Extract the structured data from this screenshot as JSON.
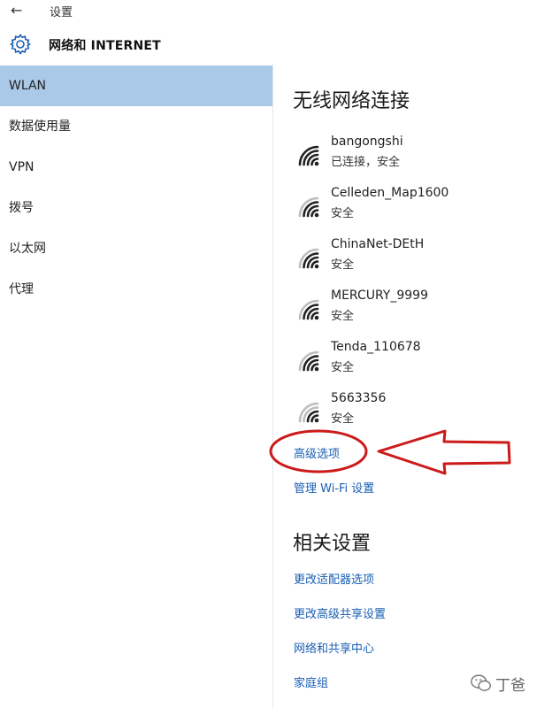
{
  "titlebar": {
    "back_glyph": "←",
    "app_title": "设置"
  },
  "header": {
    "title": "网络和 INTERNET"
  },
  "sidebar": {
    "items": [
      {
        "label": "WLAN"
      },
      {
        "label": "数据使用量"
      },
      {
        "label": "VPN"
      },
      {
        "label": "拨号"
      },
      {
        "label": "以太网"
      },
      {
        "label": "代理"
      }
    ],
    "selected_index": 0
  },
  "wireless": {
    "heading": "无线网络连接",
    "networks": [
      {
        "name": "bangongshi",
        "status": "已连接，安全"
      },
      {
        "name": "Celleden_Map1600",
        "status": "安全"
      },
      {
        "name": "ChinaNet-DEtH",
        "status": "安全"
      },
      {
        "name": "MERCURY_9999",
        "status": "安全"
      },
      {
        "name": "Tenda_110678",
        "status": "安全"
      },
      {
        "name": "5663356",
        "status": "安全"
      }
    ],
    "advanced_link": "高级选项",
    "manage_link": "管理 Wi-Fi 设置"
  },
  "related": {
    "heading": "相关设置",
    "links": [
      {
        "label": "更改适配器选项"
      },
      {
        "label": "更改高级共享设置"
      },
      {
        "label": "网络和共享中心"
      },
      {
        "label": "家庭组"
      }
    ]
  },
  "watermark": {
    "text": "丁爸"
  },
  "colors": {
    "selected": "#aac8e8",
    "link": "#1a5fb4",
    "annotation": "#cc1a1a"
  }
}
